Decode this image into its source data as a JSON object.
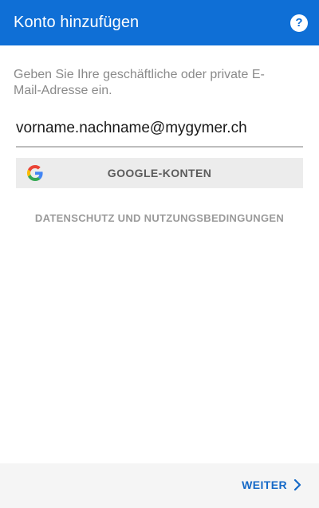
{
  "header": {
    "title": "Konto hinzufügen",
    "help_icon": "help-circle-icon",
    "help_glyph": "?"
  },
  "instruction": "Geben Sie Ihre geschäftliche oder private E-Mail-Adresse ein.",
  "email_field": {
    "value": "vorname.nachname@mygymer.ch"
  },
  "google_button": {
    "label": "GOOGLE-KONTEN",
    "icon": "google-g-icon"
  },
  "privacy_link": "DATENSCHUTZ UND NUTZUNGSBEDINGUNGEN",
  "footer": {
    "next_label": "WEITER",
    "next_icon": "chevron-right-icon"
  },
  "colors": {
    "accent": "#0F6FD6",
    "link": "#1569C7",
    "muted_text": "#8a8a8a",
    "button_bg": "#ececec",
    "footer_bg": "#f5f5f5"
  }
}
